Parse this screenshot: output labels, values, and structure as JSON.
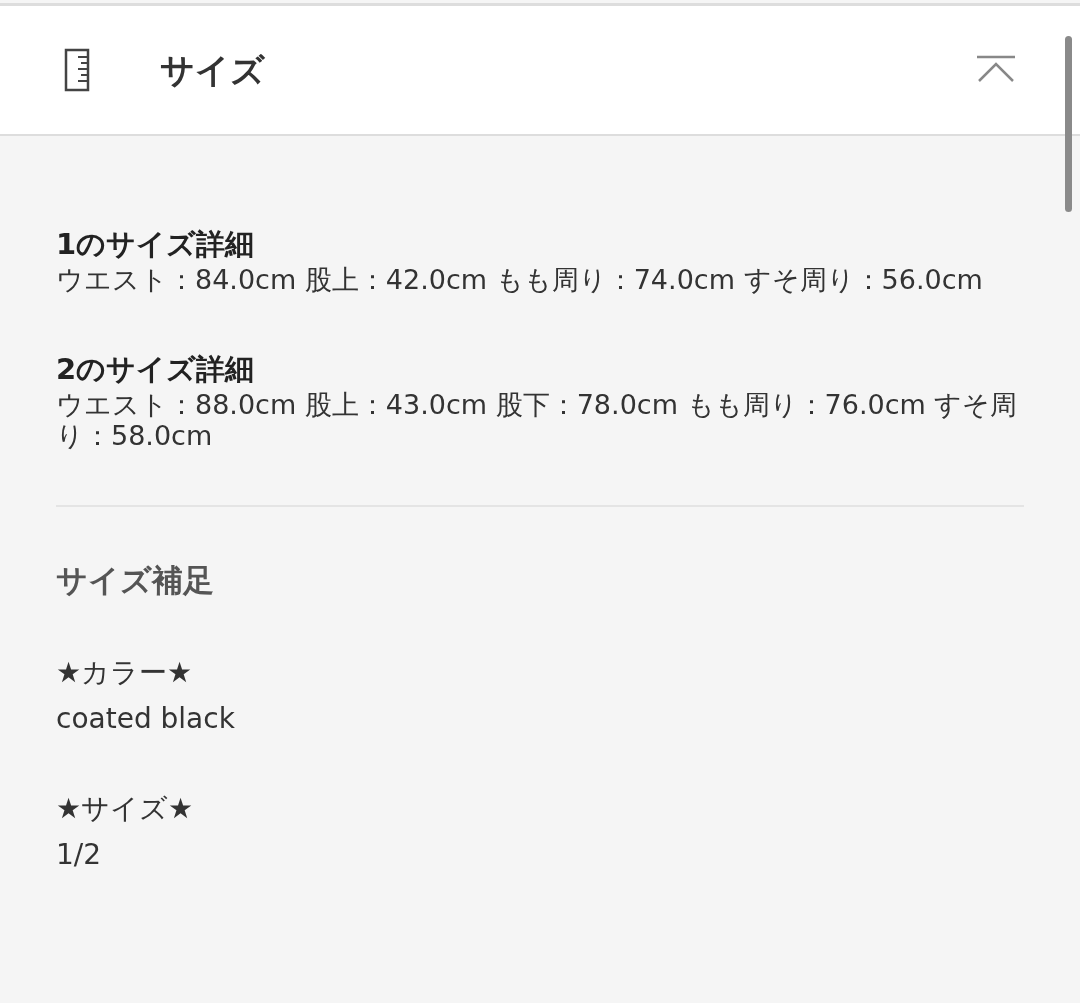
{
  "section": {
    "title": "サイズ",
    "expanded": true
  },
  "size_details": [
    {
      "heading": "1のサイズ詳細",
      "text": "ウエスト：84.0cm 股上：42.0cm もも周り：74.0cm すそ周り：56.0cm"
    },
    {
      "heading": "2のサイズ詳細",
      "text": "ウエスト：88.0cm 股上：43.0cm 股下：78.0cm もも周り：76.0cm すそ周り：58.0cm"
    }
  ],
  "supplement": {
    "heading": "サイズ補足",
    "items": [
      {
        "label": "★カラー★",
        "value": "coated black"
      },
      {
        "label": "★サイズ★",
        "value": "1/2"
      }
    ]
  }
}
